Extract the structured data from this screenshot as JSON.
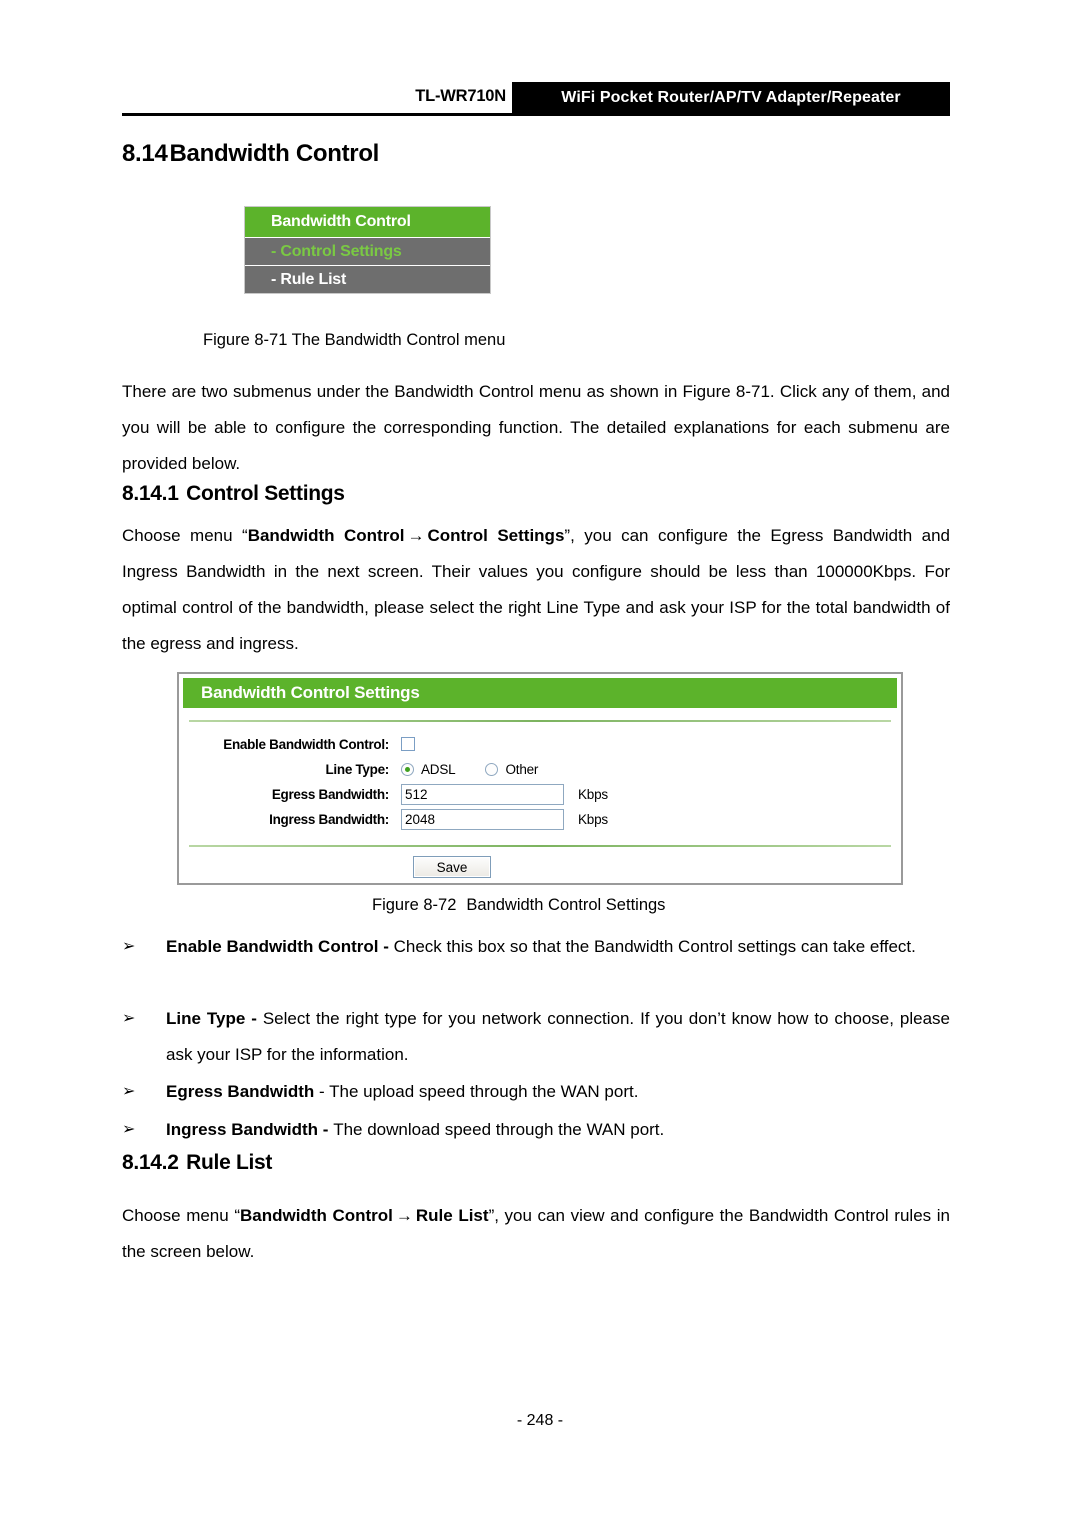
{
  "header": {
    "model": "TL-WR710N",
    "product_banner": "WiFi Pocket Router/AP/TV Adapter/Repeater"
  },
  "sections": {
    "h_814_num": "8.14",
    "h_814_title": "Bandwidth Control",
    "h_8141_num": "8.14.1",
    "h_8141_title": "Control Settings",
    "h_8142_num": "8.14.2",
    "h_8142_title": "Rule List"
  },
  "menu_figure": {
    "header": "Bandwidth Control",
    "items": [
      {
        "label": "- Control Settings",
        "state": "active"
      },
      {
        "label": "- Rule List",
        "state": "normal"
      }
    ],
    "caption": "Figure 8-71 The Bandwidth Control menu"
  },
  "paragraphs": {
    "intro": "There are two submenus under the Bandwidth Control menu as shown in Figure 8-71. Click any of them, and you will be able to configure the corresponding function. The detailed explanations for each submenu are provided below.",
    "choose1_a": "Choose menu “",
    "choose1_bold1": "Bandwidth Control",
    "choose1_arrow": "→",
    "choose1_bold2": "Control Settings",
    "choose1_b": "”, you can configure the Egress Bandwidth and Ingress Bandwidth in the next screen. Their values you configure should be less than 100000Kbps. For optimal control of the bandwidth, please select the right Line Type and ask your ISP for the total bandwidth of the egress and ingress.",
    "choose2_a": "Choose menu “",
    "choose2_bold1": "Bandwidth Control",
    "choose2_arrow": "→",
    "choose2_bold2": "Rule List",
    "choose2_b": "”, you can view and configure the Bandwidth Control rules in the screen below."
  },
  "settings_panel": {
    "title": "Bandwidth Control Settings",
    "enable_label": "Enable Bandwidth Control:",
    "enable_checked": false,
    "line_type_label": "Line Type:",
    "line_type_options": [
      {
        "label": "ADSL",
        "selected": true
      },
      {
        "label": "Other",
        "selected": false
      }
    ],
    "egress_label": "Egress Bandwidth:",
    "egress_value": "512",
    "egress_unit": "Kbps",
    "ingress_label": "Ingress Bandwidth:",
    "ingress_value": "2048",
    "ingress_unit": "Kbps",
    "save_label": "Save",
    "caption_num": "Figure 8-72",
    "caption_text": "Bandwidth Control Settings"
  },
  "bullets": [
    {
      "marker": "➢",
      "term": "Enable Bandwidth Control - ",
      "desc": "Check this box so that the Bandwidth Control settings can take effect."
    },
    {
      "marker": "➢",
      "term": "Line Type - ",
      "desc": "Select the right type for you network connection. If you don’t know how to choose, please ask your ISP for the information."
    },
    {
      "marker": "➢",
      "term": "Egress Bandwidth ",
      "desc": "- The upload speed through the WAN port."
    },
    {
      "marker": "➢",
      "term": "Ingress Bandwidth - ",
      "desc": "The download speed through the WAN port."
    }
  ],
  "footer": {
    "page_number": "- 248 -"
  },
  "colors": {
    "green_header": "#5cb32b",
    "menu_gray": "#6e6e6e",
    "active_green_text": "#7ac943",
    "radio_dot": "#3fa021"
  }
}
